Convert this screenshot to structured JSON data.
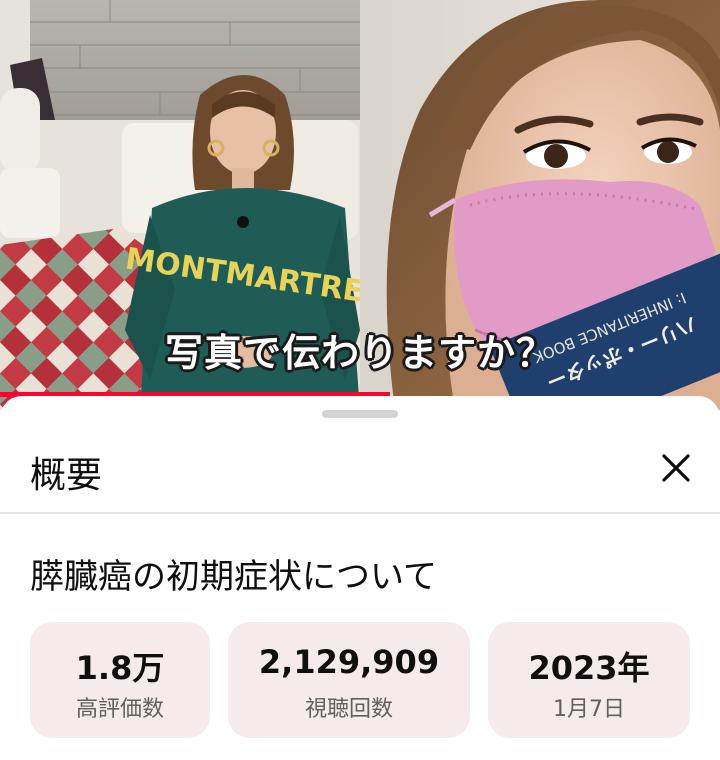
{
  "video": {
    "caption": "写真で伝わりますか？",
    "sweatshirt_text": "MONTMARTRE",
    "book_text_line1": "I: INHERITANCE BOOK I",
    "book_text_line2": "ハリー・ポッター"
  },
  "sheet": {
    "title": "概要",
    "close_icon": "close-icon",
    "video_title": "膵臓癌の初期症状について",
    "stats": {
      "likes": {
        "value": "1.8万",
        "label": "高評価数"
      },
      "views": {
        "value": "2,129,909",
        "label": "視聴回数"
      },
      "date": {
        "value": "2023年",
        "label": "1月7日"
      }
    }
  },
  "colors": {
    "sheet_background": "#ffffff",
    "stat_card": "#f5ebea",
    "progress_red": "#ff0033",
    "sweater_green": "#1f5c55",
    "mask_pink": "#e29ac6"
  }
}
